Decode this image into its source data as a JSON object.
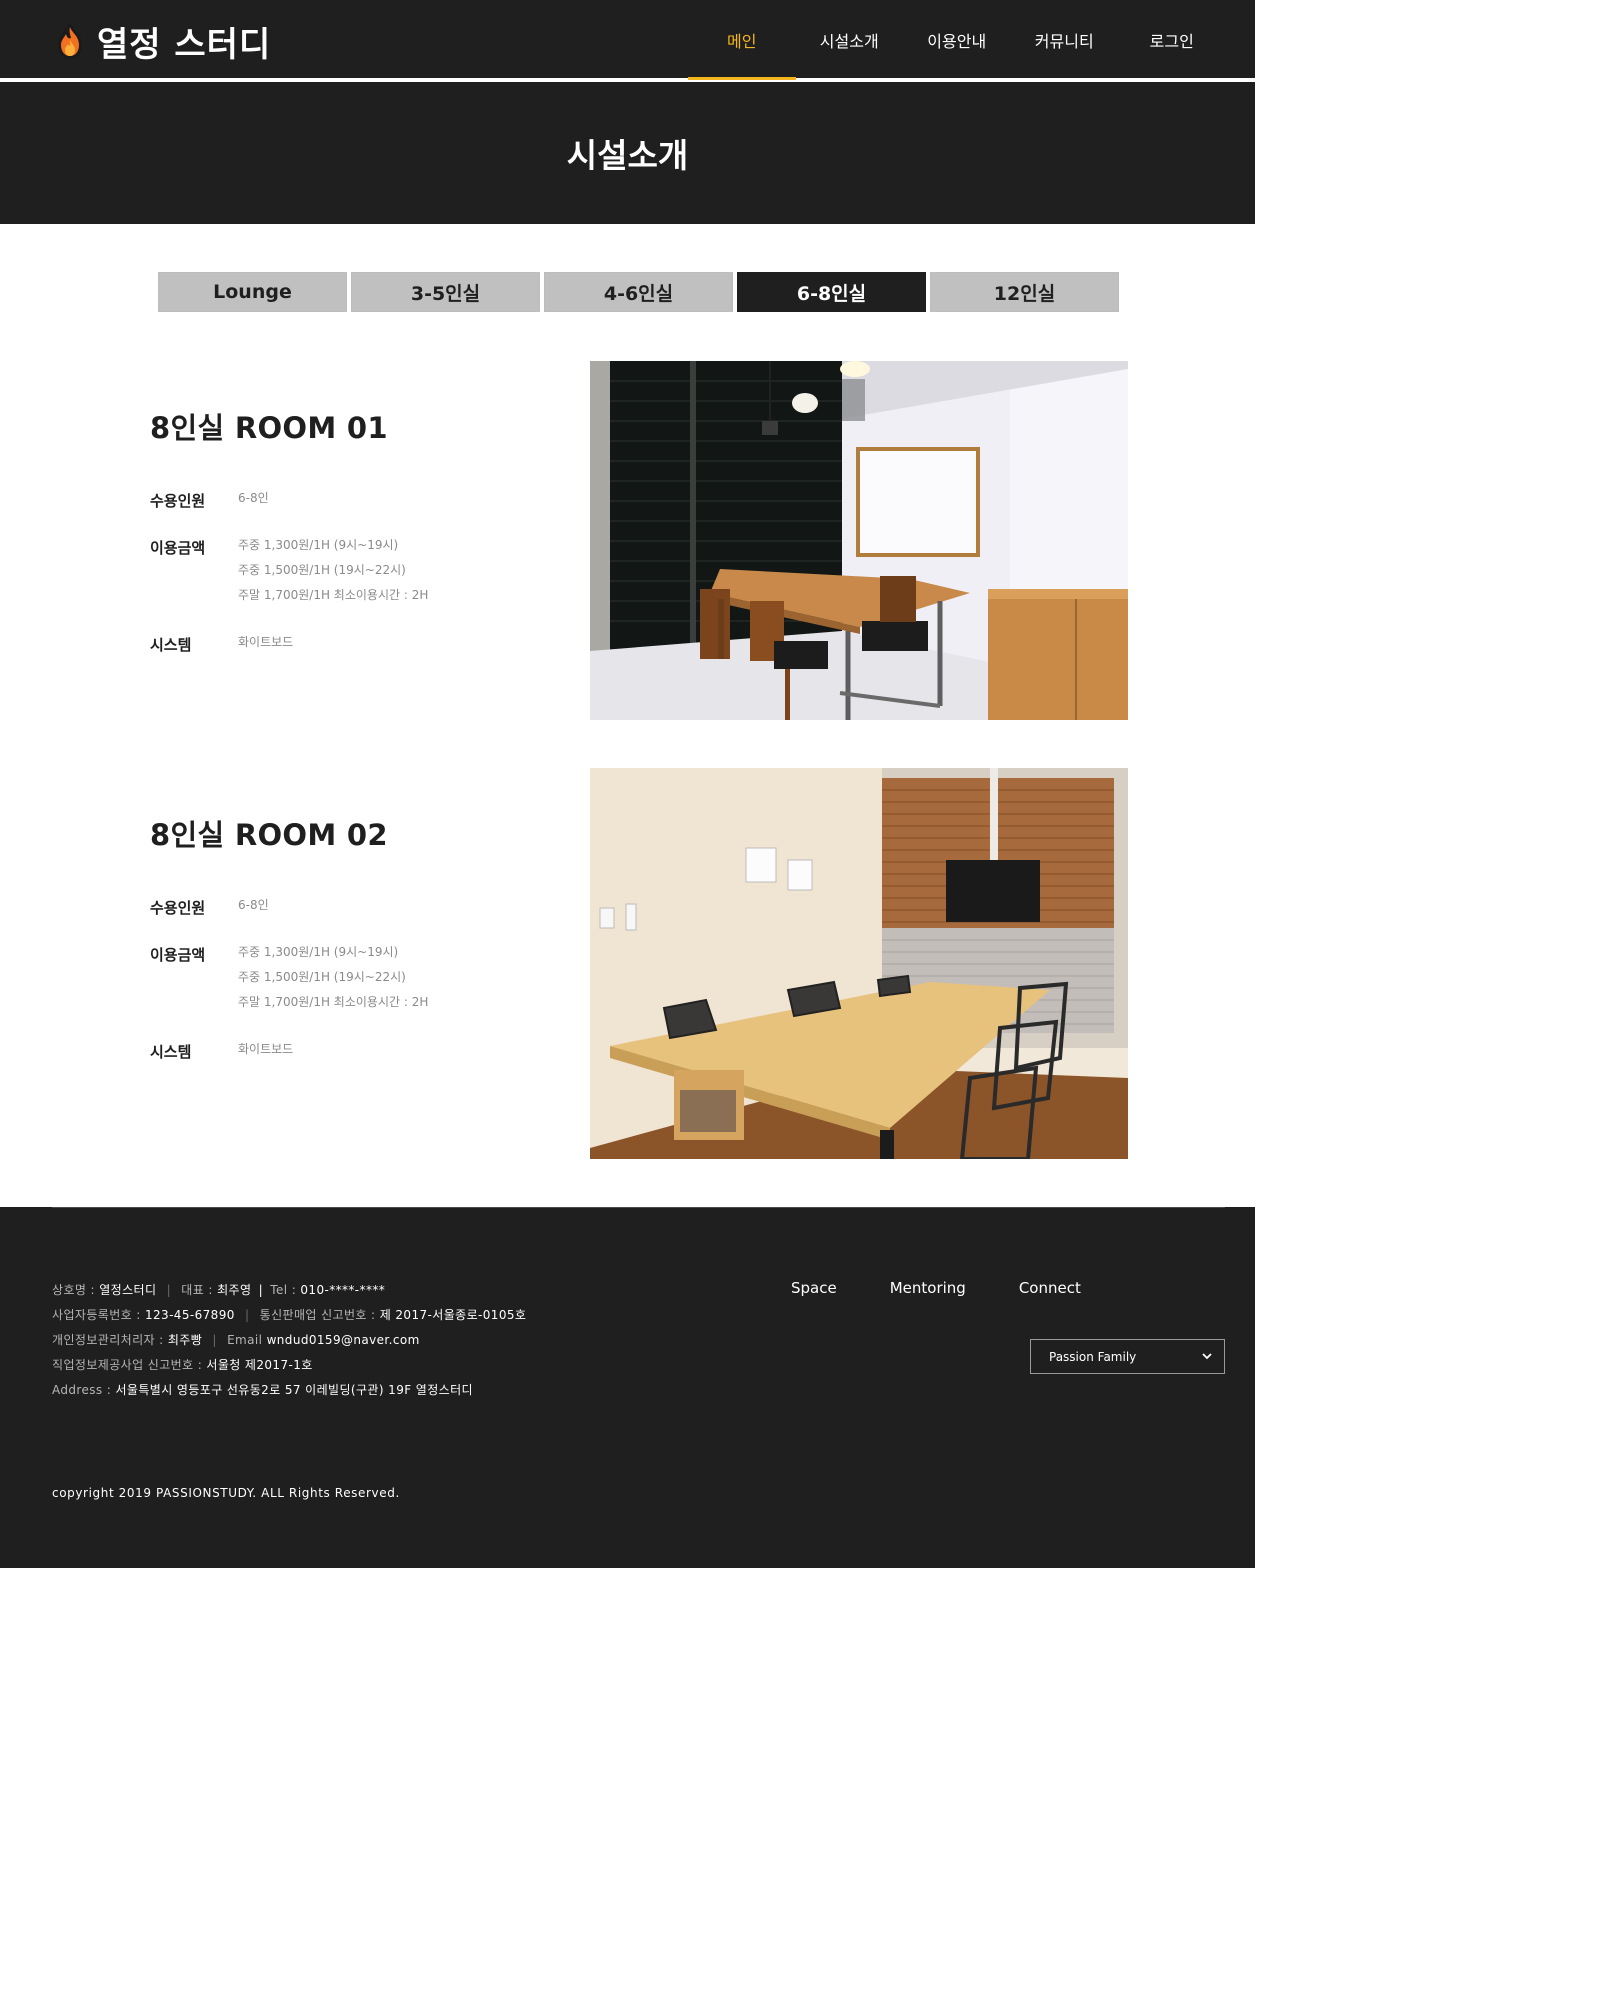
{
  "header": {
    "logo_text": "열정 스터디",
    "nav": [
      {
        "label": "메인",
        "active": true
      },
      {
        "label": "시설소개",
        "active": false
      },
      {
        "label": "이용안내",
        "active": false
      },
      {
        "label": "커뮤니티",
        "active": false
      },
      {
        "label": "로그인",
        "active": false
      }
    ]
  },
  "banner": {
    "title": "시설소개"
  },
  "tabs": [
    {
      "label": "Lounge",
      "active": false
    },
    {
      "label": "3-5인실",
      "active": false
    },
    {
      "label": "4-6인실",
      "active": false
    },
    {
      "label": "6-8인실",
      "active": true
    },
    {
      "label": "12인실",
      "active": false
    }
  ],
  "rooms": [
    {
      "title": "8인실 ROOM 01",
      "capacity_label": "수용인원",
      "capacity": "6-8인",
      "price_label": "이용금액",
      "prices": [
        "주중 1,300원/1H (9시~19시)",
        "주중 1,500원/1H (19시~22시)",
        "주말 1,700원/1H 최소이용시간 : 2H"
      ],
      "system_label": "시스템",
      "system": "화이트보드"
    },
    {
      "title": "8인실 ROOM 02",
      "capacity_label": "수용인원",
      "capacity": "6-8인",
      "price_label": "이용금액",
      "prices": [
        "주중 1,300원/1H (9시~19시)",
        "주중 1,500원/1H (19시~22시)",
        "주말 1,700원/1H 최소이용시간 : 2H"
      ],
      "system_label": "시스템",
      "system": "화이트보드"
    }
  ],
  "footer": {
    "company_label": "상호명 :",
    "company": "열정스터디",
    "ceo_label": "대표 :",
    "ceo": "최주영",
    "tel_label": "Tel :",
    "tel": "010-****-****",
    "bizno_label": "사업자등록번호 :",
    "bizno": "123-45-67890",
    "ecommerce_label": "통신판매업 신고번호 :",
    "ecommerce": "제 2017-서울종로-0105호",
    "privacy_label": "개인정보관리처리자 :",
    "privacy": "최주빵",
    "email_label": "Email",
    "email": "wndud0159@naver.com",
    "job_label": "직업정보제공사업 신고번호 :",
    "job": "서울청 제2017-1호",
    "address_label": "Address :",
    "address": "서울특별시 영등포구 선유동2로 57 이레빌딩(구관) 19F 열정스터디",
    "links": [
      "Space",
      "Mentoring",
      "Connect"
    ],
    "family_select": "Passion Family",
    "copyright": "copyright 2019 PASSIONSTUDY. ALL Rights Reserved."
  },
  "colors": {
    "dark": "#1f1f1f",
    "accent": "#f5b51c",
    "tab": "#c0c0c0"
  },
  "icons": {
    "logo": "flame-icon",
    "select": "chevron-down-icon"
  }
}
